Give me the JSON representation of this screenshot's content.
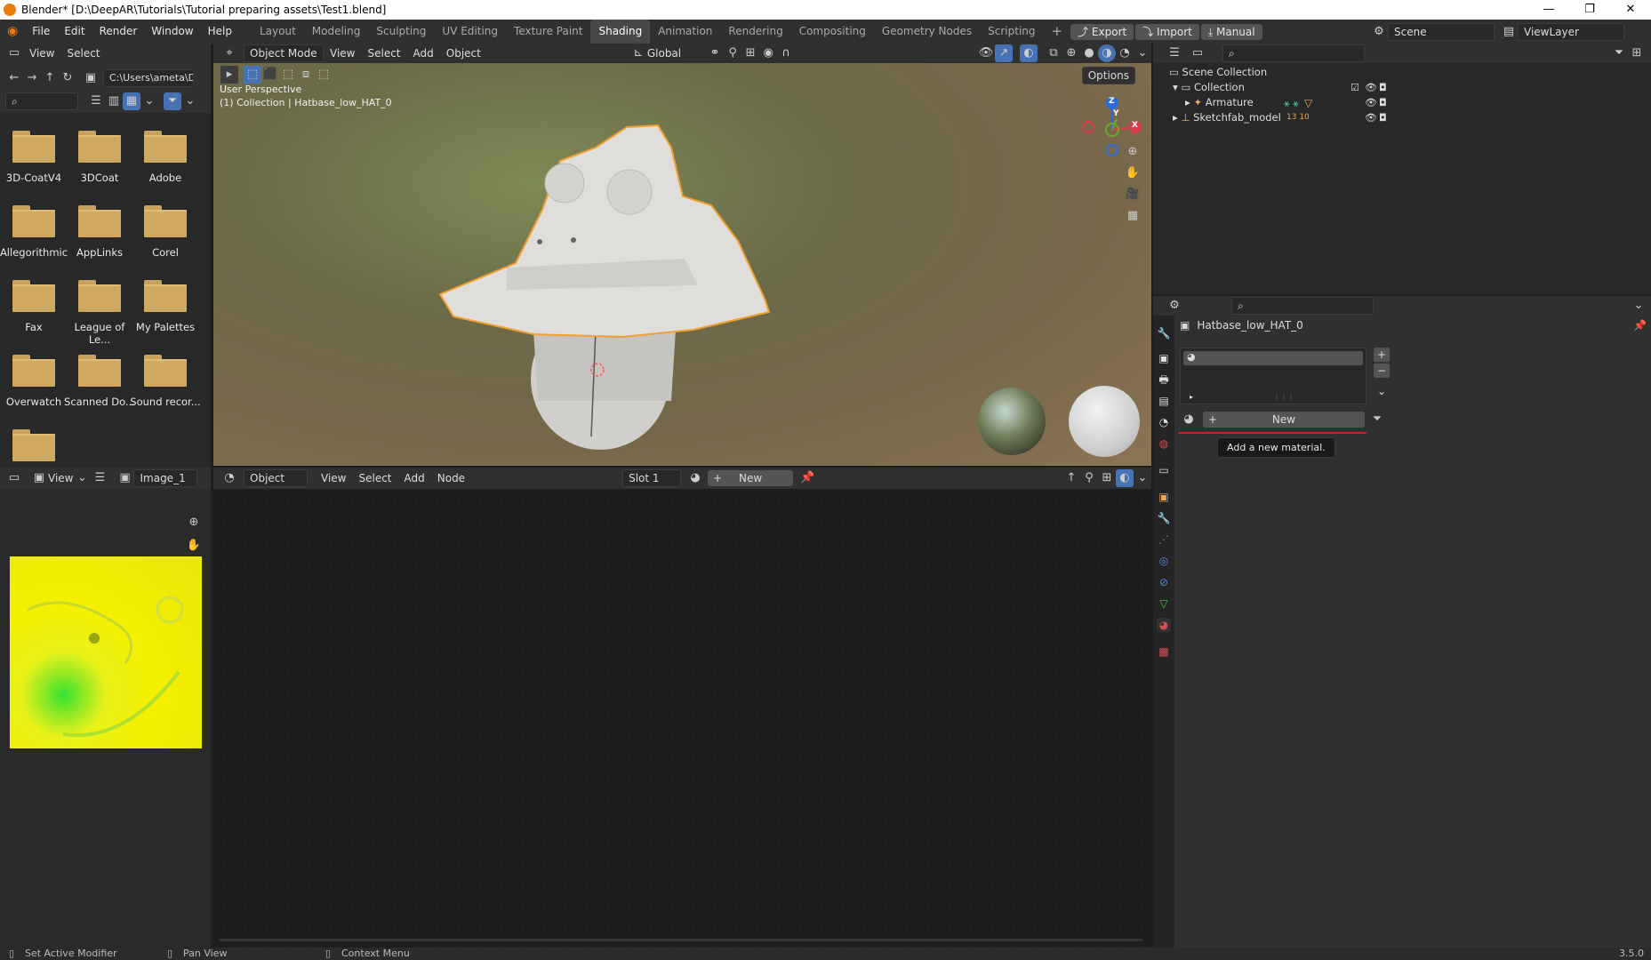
{
  "titlebar": {
    "title": "Blender* [D:\\DeepAR\\Tutorials\\Tutorial preparing assets\\Test1.blend]",
    "minimize": "—",
    "restore": "❐",
    "close": "✕"
  },
  "menu": {
    "items": [
      "File",
      "Edit",
      "Render",
      "Window",
      "Help"
    ]
  },
  "workspaces": {
    "tabs": [
      "Layout",
      "Modeling",
      "Sculpting",
      "UV Editing",
      "Texture Paint",
      "Shading",
      "Animation",
      "Rendering",
      "Compositing",
      "Geometry Nodes",
      "Scripting"
    ],
    "active": "Shading",
    "add": "+"
  },
  "addon_buttons": {
    "export": "Export",
    "import": "Import",
    "manual": "Manual"
  },
  "scene": {
    "label": "Scene",
    "viewlayer": "ViewLayer"
  },
  "filebrowser": {
    "menu": [
      "View",
      "Select"
    ],
    "path": "C:\\Users\\ameta\\Do...",
    "folders": [
      "3D-CoatV4",
      "3DCoat",
      "Adobe",
      "Allegorithmic",
      "AppLinks",
      "Corel",
      "Fax",
      "League of Le...",
      "My Palettes",
      "Overwatch",
      "Scanned Do...",
      "Sound recor...",
      ""
    ]
  },
  "viewport": {
    "mode": "Object Mode",
    "menu": [
      "View",
      "Select",
      "Add",
      "Object"
    ],
    "orientation": "Global",
    "options": "Options",
    "overlay_line1": "User Perspective",
    "overlay_line2": "(1) Collection | Hatbase_low_HAT_0",
    "gizmo": {
      "z": "Z",
      "y": "Y",
      "x": "X"
    }
  },
  "outliner": {
    "root": "Scene Collection",
    "collection": "Collection",
    "items": [
      "Armature",
      "Sketchfab_model"
    ],
    "badge": "13 10"
  },
  "properties": {
    "object_name": "Hatbase_low_HAT_0",
    "new_button": "New",
    "tooltip": "Add a new material.",
    "expand": "⋮⋮⋮"
  },
  "image_editor": {
    "menu": "View",
    "image_name": "Image_1"
  },
  "node_editor": {
    "mode": "Object",
    "menu": [
      "View",
      "Select",
      "Add",
      "Node"
    ],
    "slot": "Slot 1",
    "new_button": "New"
  },
  "statusbar": {
    "items": [
      "Set Active Modifier",
      "Pan View",
      "Context Menu"
    ],
    "version": "3.5.0"
  },
  "colors": {
    "accent_orange": "#e87d0d",
    "selection_outline": "#f0a030",
    "active_blue": "#4772b3"
  }
}
